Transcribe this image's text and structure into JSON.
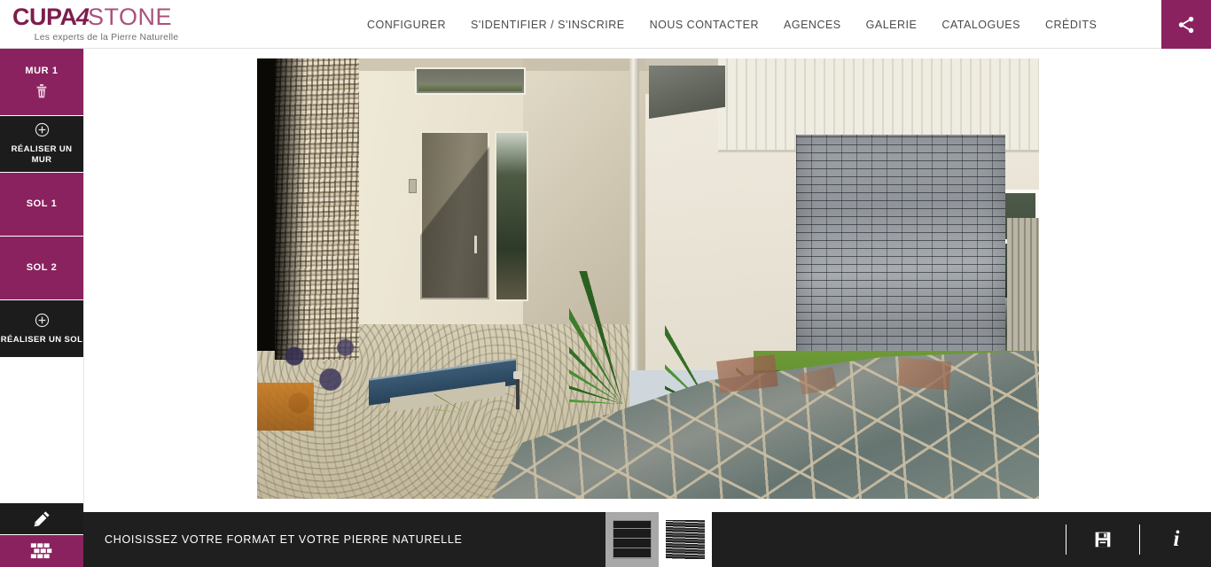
{
  "header": {
    "logo": {
      "part1": "CUPA",
      "part2": "4",
      "part3": "STONE",
      "tagline": "Les experts de la Pierre Naturelle"
    },
    "nav": [
      {
        "label": "CONFIGURER"
      },
      {
        "label": "S'IDENTIFIER / S'INSCRIRE"
      },
      {
        "label": "NOUS CONTACTER"
      },
      {
        "label": "AGENCES"
      },
      {
        "label": "GALERIE"
      },
      {
        "label": "CATALOGUES"
      },
      {
        "label": "CRÉDITS"
      }
    ],
    "share_icon": "share-icon",
    "accent_color": "#8a2260"
  },
  "sidebar": {
    "items": [
      {
        "label": "MUR 1",
        "sub": "",
        "style": "magenta",
        "icon": "trash-icon"
      },
      {
        "label": "",
        "sub": "RÉALISER UN MUR",
        "style": "dark",
        "icon": "plus-circle-icon"
      },
      {
        "label": "SOL 1",
        "sub": "",
        "style": "magenta",
        "icon": ""
      },
      {
        "label": "SOL 2",
        "sub": "",
        "style": "magenta",
        "icon": ""
      },
      {
        "label": "",
        "sub": "RÉALISER UN SOL",
        "style": "dark",
        "icon": "plus-circle-icon"
      }
    ]
  },
  "canvas": {
    "preview_alt": "Maison moderne avec mur en pierre naturelle grise et terrasse en dallage irrégulier"
  },
  "bottombar": {
    "tools": [
      {
        "name": "pencil-tool",
        "icon": "pencil-icon",
        "active": false
      },
      {
        "name": "brick-tool",
        "icon": "brick-icon",
        "active": true
      }
    ],
    "title": "CHOISISSEZ VOTRE FORMAT ET VOTRE PIERRE NATURELLE",
    "thumbnails": [
      {
        "name": "format-grid",
        "icon": "grid-thumbnail",
        "selected": true
      },
      {
        "name": "stone-texture",
        "icon": "stone-thumbnail",
        "selected": false
      }
    ],
    "actions": [
      {
        "name": "save-button",
        "icon": "floppy-save-icon"
      },
      {
        "name": "info-button",
        "icon": "info-icon",
        "glyph": "i"
      }
    ]
  }
}
